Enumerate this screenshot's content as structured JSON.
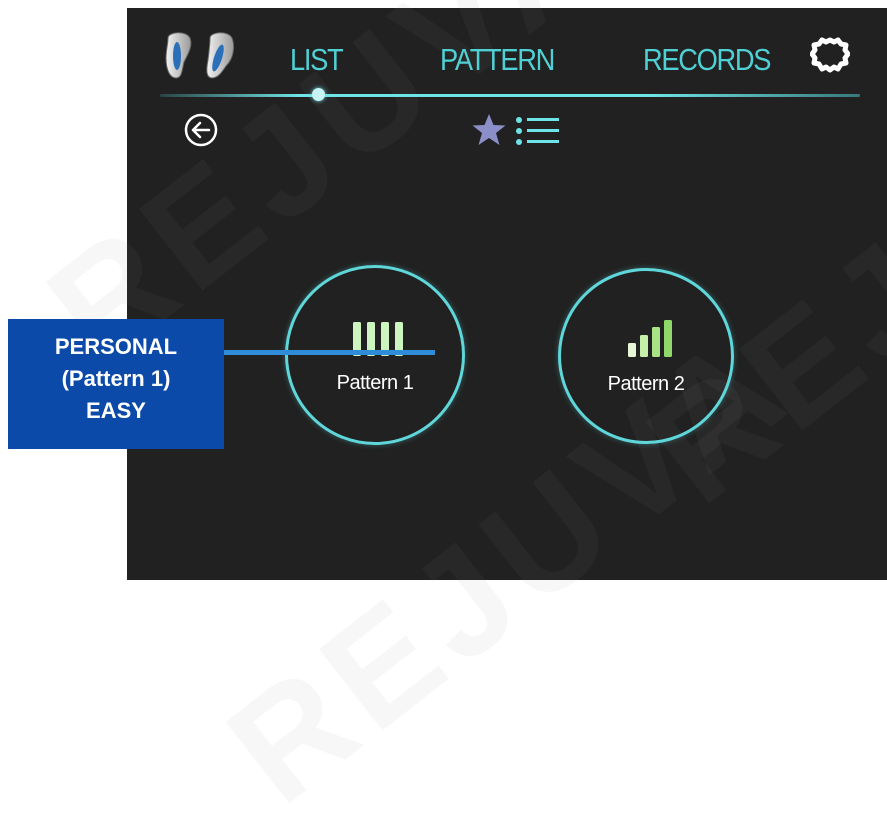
{
  "nav": {
    "tabs": [
      {
        "label": "LIST",
        "active": true
      },
      {
        "label": "PATTERN",
        "active": false
      },
      {
        "label": "RECORDS",
        "active": false
      }
    ],
    "icons": [
      "earbuds-icon",
      "gear-icon"
    ]
  },
  "toolbar": {
    "icons": [
      "back-arrow-icon",
      "star-icon",
      "list-icon"
    ]
  },
  "patterns": [
    {
      "label": "Pattern 1",
      "bars": [
        1,
        1,
        1,
        1
      ]
    },
    {
      "label": "Pattern 2",
      "bars": [
        0.35,
        0.55,
        0.8,
        1
      ]
    }
  ],
  "callout": {
    "line1": "PERSONAL",
    "line2": "(Pattern 1)",
    "line3": "EASY"
  },
  "watermark": "REJUVA",
  "colors": {
    "screen_bg": "#212121",
    "accent": "#4fd0d4",
    "bar_light": "#cdf5c0",
    "bar_green": "#8fd96b",
    "callout_bg": "#0b4aa8",
    "connector": "#2f8cd9"
  }
}
